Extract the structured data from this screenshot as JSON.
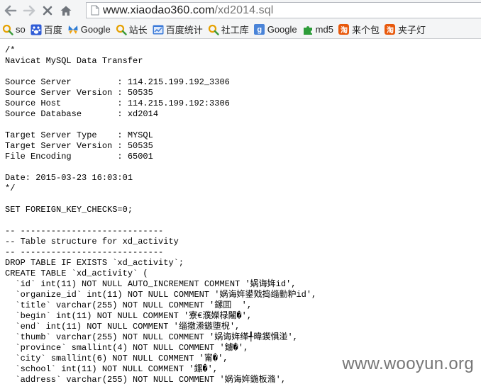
{
  "browser": {
    "address": {
      "host": "www.xiaodao360.com",
      "path": "/xd2014.sql"
    },
    "nav_icons": [
      "back-arrow-icon",
      "forward-arrow-icon",
      "stop-icon",
      "home-icon"
    ],
    "bookmarks": [
      {
        "label": "so",
        "icon": "search-magnifier-icon",
        "color": "#e6a100"
      },
      {
        "label": "百度",
        "icon": "baidu-paw-icon",
        "color": "#2f5cd6"
      },
      {
        "label": "Google",
        "icon": "butterfly-icon",
        "color": "#2d7bd4"
      },
      {
        "label": "站长",
        "icon": "search-magnifier-icon",
        "color": "#e6a100"
      },
      {
        "label": "百度统计",
        "icon": "chart-window-icon",
        "color": "#3b7ad8"
      },
      {
        "label": "社工库",
        "icon": "search-magnifier-icon",
        "color": "#e6a100"
      },
      {
        "label": "Google",
        "icon": "google-g-icon",
        "color": "#4a84d8",
        "glyph": "g"
      },
      {
        "label": "md5",
        "icon": "puzzle-icon",
        "color": "#2e9d3a"
      },
      {
        "label": "来个包",
        "icon": "taobao-icon",
        "color": "#e8590c",
        "glyph": "淘"
      },
      {
        "label": "夹子灯",
        "icon": "taobao-icon",
        "color": "#e8590c",
        "glyph": "淘"
      }
    ]
  },
  "sql_lines": [
    "/*",
    "Navicat MySQL Data Transfer",
    "",
    "Source Server         : 114.215.199.192_3306",
    "Source Server Version : 50535",
    "Source Host           : 114.215.199.192:3306",
    "Source Database       : xd2014",
    "",
    "Target Server Type    : MYSQL",
    "Target Server Version : 50535",
    "File Encoding         : 65001",
    "",
    "Date: 2015-03-23 16:03:01",
    "*/",
    "",
    "SET FOREIGN_KEY_CHECKS=0;",
    "",
    "-- ----------------------------",
    "-- Table structure for xd_activity",
    "-- ----------------------------",
    "DROP TABLE IF EXISTS `xd_activity`;",
    "CREATE TABLE `xd_activity` (",
    "  `id` int(11) NOT NULL AUTO_INCREMENT COMMENT '娲诲姩id',",
    "  `organize_id` int(11) NOT NULL COMMENT '娲诲姩鍙戣捣缁勭粐id',",
    "  `title` varchar(255) NOT NULL COMMENT '鏍囬  ',",
    "  `begin` int(11) NOT NULL COMMENT '寮€濮嬫椂闂�',",
    "  `end` int(11) NOT NULL COMMENT '缁撴潫鏃堕棿',",
    "  `thumb` varchar(255) NOT NULL COMMENT '娲诲姩缂╃暐鍥惧湴',",
    "  `province` smallint(4) NOT NULL COMMENT '鐪�',",
    "  `city` smallint(6) NOT NULL COMMENT '甯�',",
    "  `school` int(11) NOT NULL COMMENT '鏍�',",
    "  `address` varchar(255) NOT NULL COMMENT '娲诲姩鍦板潃',"
  ],
  "watermark": "www.wooyun.org",
  "colors": {
    "chrome": "#f4f5f6",
    "text": "#000000",
    "url_path": "#767676",
    "watermark": "#5f5f5f"
  }
}
